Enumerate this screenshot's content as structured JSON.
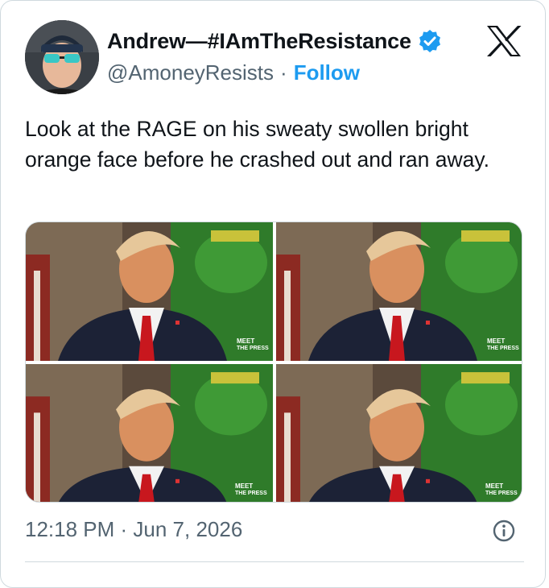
{
  "author": {
    "display_name": "Andrew—#IAmTheResistance",
    "handle": "@AmoneyResists",
    "separator": "·",
    "follow_label": "Follow",
    "verified": true,
    "avatar_icon": "user-avatar"
  },
  "platform_icon": "x-logo-icon",
  "tweet": {
    "text": "Look at the RAGE on his sweaty swollen bright orange face before he crashed out and ran away."
  },
  "media": {
    "watermark": "MEET THE PRESS",
    "images": [
      "photo-1",
      "photo-2",
      "photo-3",
      "photo-4"
    ]
  },
  "meta": {
    "timestamp": "12:18 PM · Jun 7, 2026",
    "info_icon": "info-icon"
  },
  "colors": {
    "accent": "#1d9bf0",
    "secondary_text": "#536471",
    "border": "#cfd9de"
  }
}
